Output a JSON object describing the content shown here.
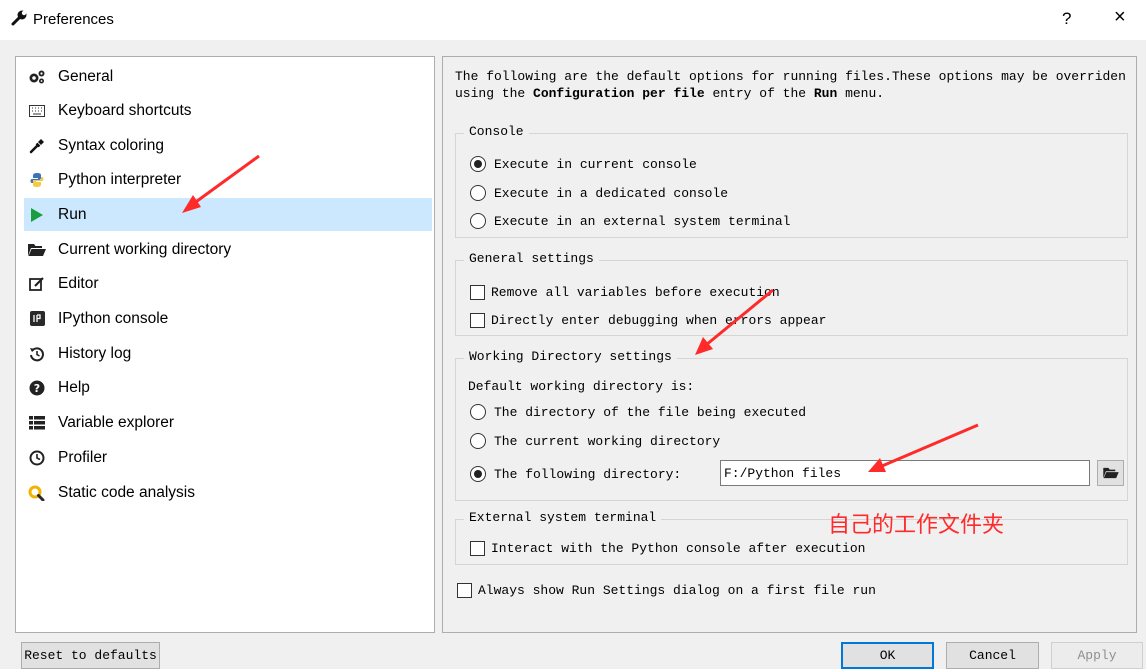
{
  "window": {
    "title": "Preferences",
    "help_label": "?",
    "close_label": "×"
  },
  "sidebar": {
    "items": [
      {
        "label": "General",
        "icon": "gears-icon"
      },
      {
        "label": "Keyboard shortcuts",
        "icon": "keyboard-icon"
      },
      {
        "label": "Syntax coloring",
        "icon": "eyedropper-icon"
      },
      {
        "label": "Python interpreter",
        "icon": "python-icon"
      },
      {
        "label": "Run",
        "icon": "play-icon",
        "selected": true
      },
      {
        "label": "Current working directory",
        "icon": "folder-open-icon"
      },
      {
        "label": "Editor",
        "icon": "edit-icon"
      },
      {
        "label": "IPython console",
        "icon": "ipython-icon"
      },
      {
        "label": "History log",
        "icon": "history-icon"
      },
      {
        "label": "Help",
        "icon": "question-circle-icon"
      },
      {
        "label": "Variable explorer",
        "icon": "table-list-icon"
      },
      {
        "label": "Profiler",
        "icon": "clock-icon"
      },
      {
        "label": "Static code analysis",
        "icon": "magnifier-icon"
      }
    ]
  },
  "run": {
    "description_part1": "The following are the default options for running files.These options may be overriden",
    "description_part2_prefix": "using the ",
    "description_bold1": "Configuration per file",
    "description_mid": " entry of the ",
    "description_bold2": "Run",
    "description_suffix": " menu.",
    "console": {
      "title": "Console",
      "options": [
        "Execute in current console",
        "Execute in a dedicated console",
        "Execute in an external system terminal"
      ],
      "selected_index": 0
    },
    "general": {
      "title": "General settings",
      "remove_vars_label": "Remove all variables before execution",
      "remove_vars_checked": false,
      "debug_label": "Directly enter debugging when errors appear",
      "debug_checked": false
    },
    "workdir": {
      "title": "Working Directory settings",
      "subtitle": "Default working directory is:",
      "options": [
        "The directory of the file being executed",
        "The current working directory",
        "The following directory:"
      ],
      "selected_index": 2,
      "path_value": "F:/Python files"
    },
    "external": {
      "title": "External system terminal",
      "interact_label": "Interact with the Python console after execution",
      "interact_checked": false
    },
    "always_show_label": "Always show Run Settings dialog on a first file run",
    "always_show_checked": false
  },
  "annotation_text": "自己的工作文件夹",
  "buttons": {
    "reset": "Reset to defaults",
    "ok": "OK",
    "cancel": "Cancel",
    "apply": "Apply"
  },
  "colors": {
    "selection": "#cce8ff",
    "annotation": "#ff2a2a",
    "run_icon": "#1a9e3f",
    "python_blue": "#3b74b6",
    "python_yellow": "#f6c844",
    "analysis_yellow": "#f0b400"
  }
}
